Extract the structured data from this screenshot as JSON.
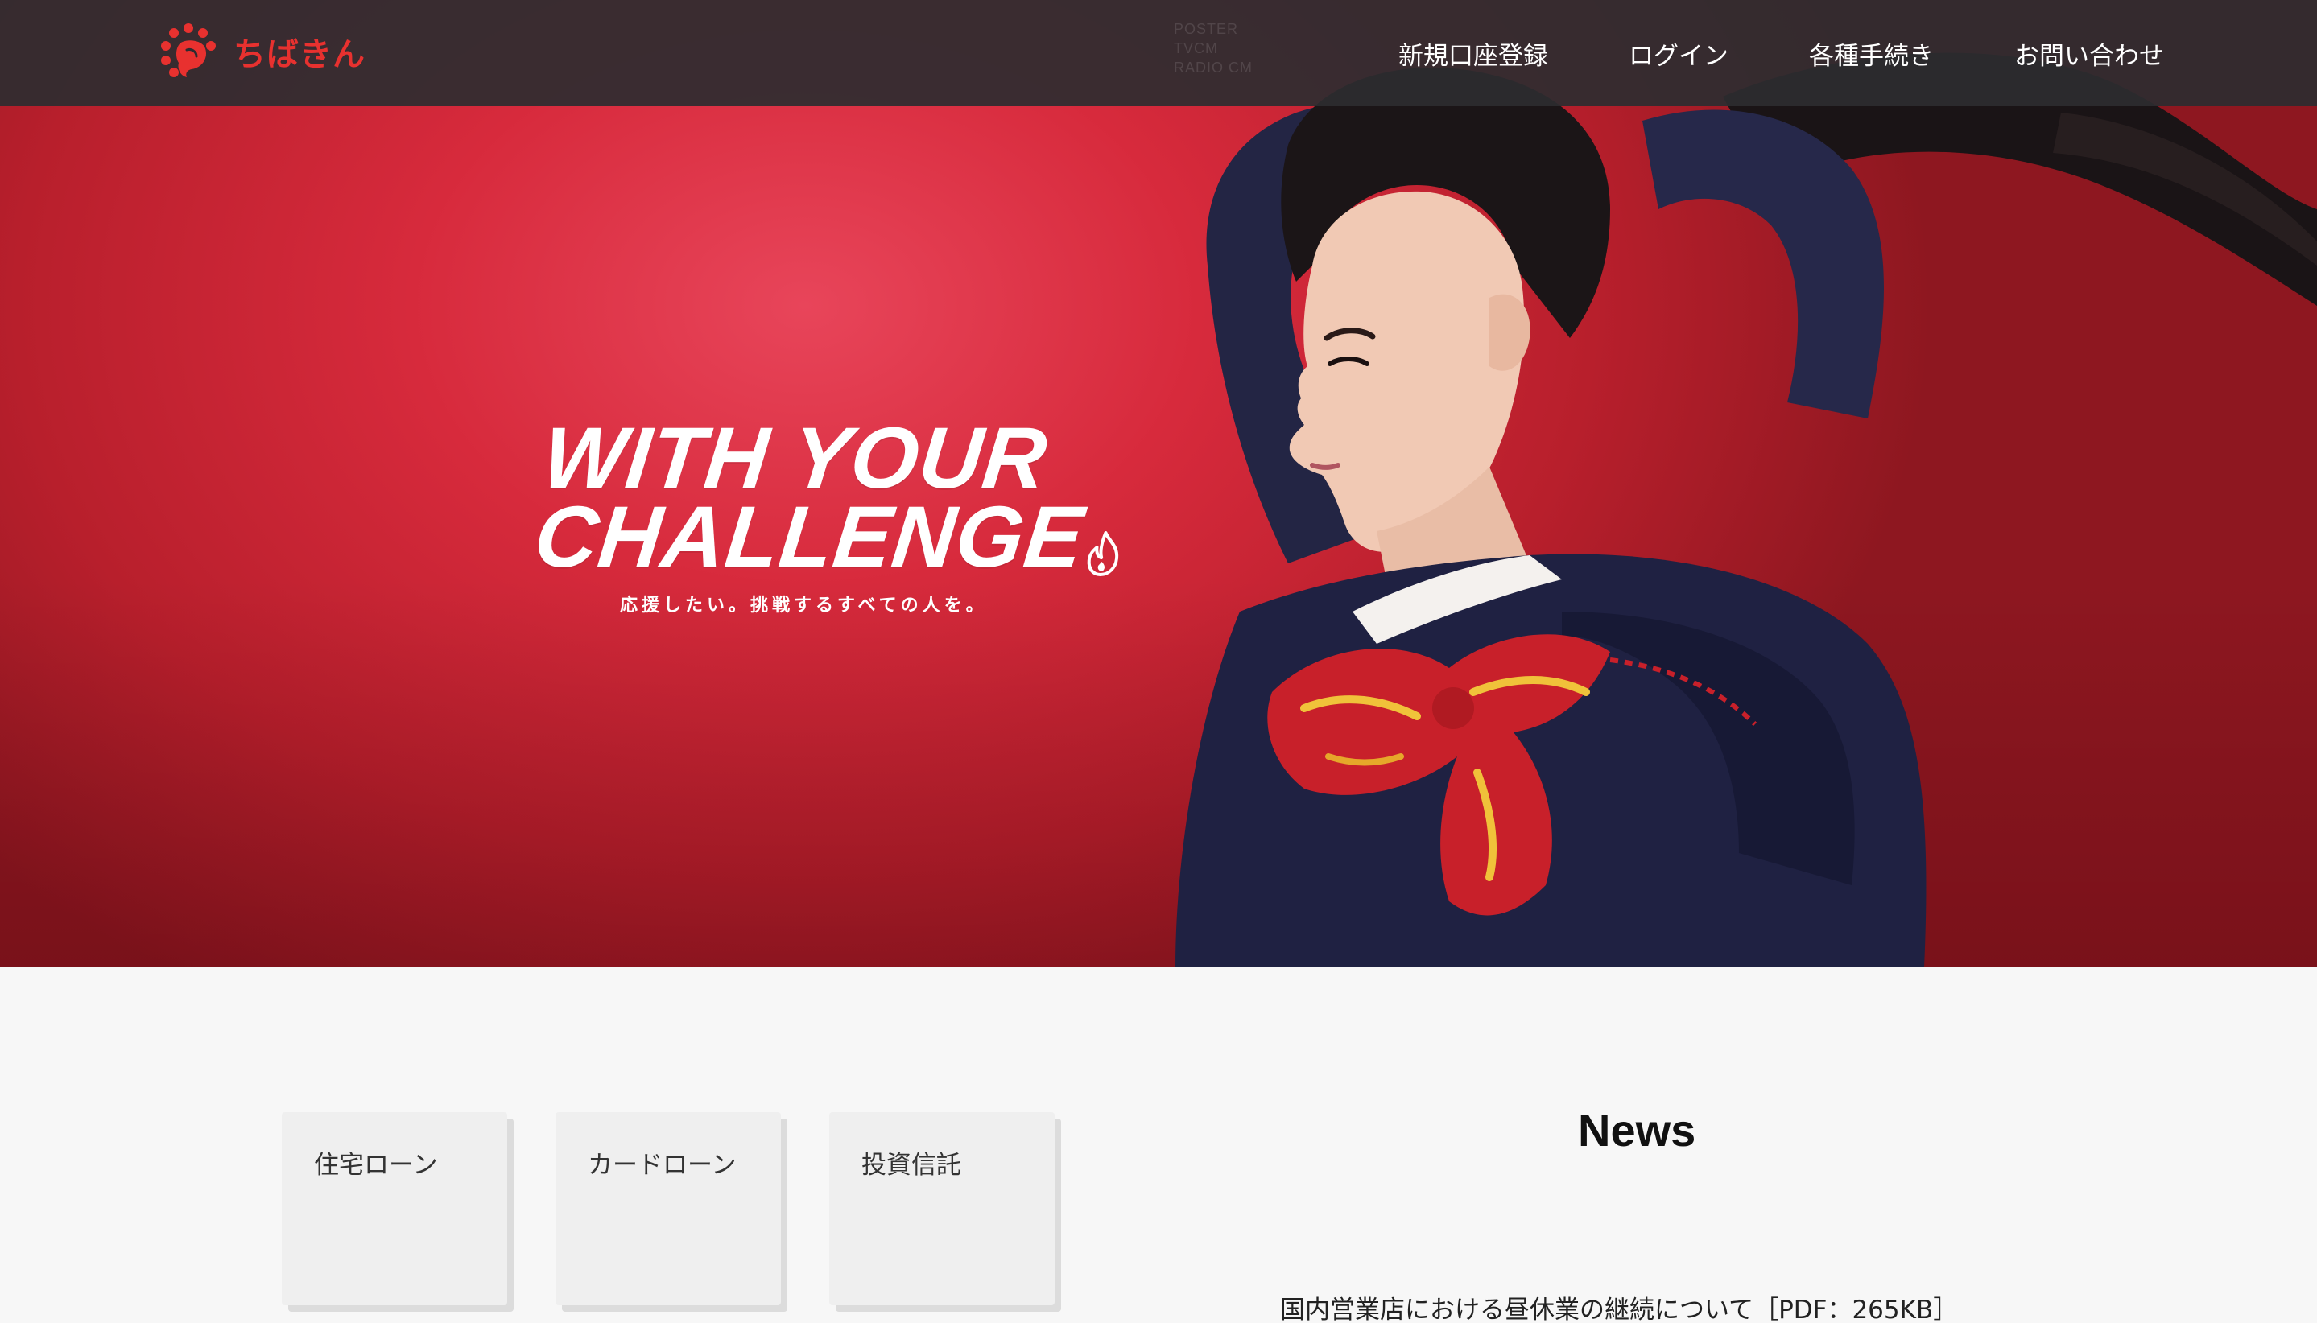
{
  "header": {
    "logo_text": "ちばきん",
    "ghost_lines": [
      "POSTER",
      "TVCM",
      "RADIO CM"
    ],
    "nav": [
      {
        "label": "新規口座登録"
      },
      {
        "label": "ログイン"
      },
      {
        "label": "各種手続き"
      },
      {
        "label": "お問い合わせ"
      }
    ]
  },
  "hero": {
    "title_line1": "WITH YOUR",
    "title_line2": "CHALLENGE",
    "subtitle": "応援したい。挑戦するすべての人を。",
    "flame_icon": "flame-icon"
  },
  "products": {
    "cards": [
      {
        "label": "住宅ローン"
      },
      {
        "label": "カードローン"
      },
      {
        "label": "投資信託"
      }
    ]
  },
  "news": {
    "title": "News",
    "items": [
      {
        "text": "国内営業店における昼休業の継続について［PDF：265KB］"
      }
    ]
  },
  "colors": {
    "header_bg": "#2c2c30",
    "brand_red": "#e8312f",
    "hero_red": "#d72a3c",
    "page_bg": "#f7f7f7",
    "card_bg": "#efefef"
  }
}
